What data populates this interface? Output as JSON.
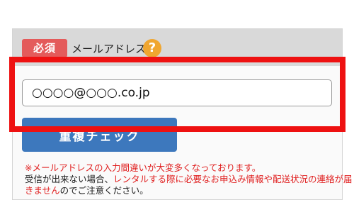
{
  "field": {
    "required_label": "必須",
    "label": "メールアドレス",
    "help_icon": "question-circle-icon",
    "value": "○○○○@○○○.co.jp"
  },
  "check_button": {
    "label": "重複チェック"
  },
  "notice": {
    "line1_red": "※メールアドレスの入力間違いが大変多くなっております。",
    "line2_black_a": "受信が出来ない場合、",
    "line2_red": "レンタルする際に必要なお申込み情報や配送状況の連絡が届",
    "line3_red": "きません",
    "line3_black": "のでご注意ください。"
  },
  "colors": {
    "required_badge": "#e45b5b",
    "help_icon": "#f0a630",
    "button": "#3d78bd",
    "highlight": "#ee1111",
    "warning_text": "#e02020"
  }
}
